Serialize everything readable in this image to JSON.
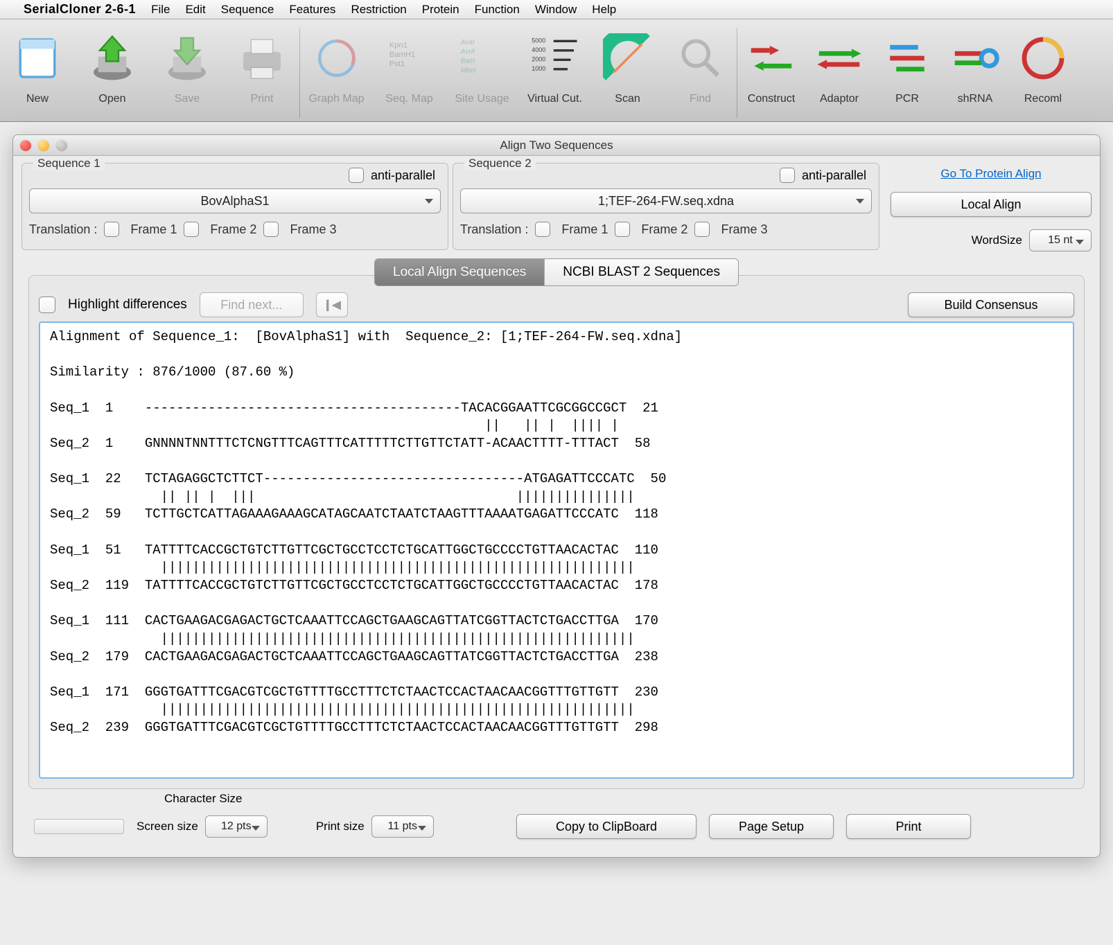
{
  "menubar": {
    "appname": "SerialCloner 2-6-1",
    "items": [
      "File",
      "Edit",
      "Sequence",
      "Features",
      "Restriction",
      "Protein",
      "Function",
      "Window",
      "Help"
    ]
  },
  "toolbar": [
    {
      "label": "New",
      "icon": "new"
    },
    {
      "label": "Open",
      "icon": "open"
    },
    {
      "label": "Save",
      "icon": "save",
      "disabled": true
    },
    {
      "label": "Print",
      "icon": "print",
      "disabled": true
    },
    {
      "divider": true
    },
    {
      "label": "Graph Map",
      "icon": "graphmap",
      "disabled": true
    },
    {
      "label": "Seq. Map",
      "icon": "seqmap",
      "disabled": true
    },
    {
      "label": "Site Usage",
      "icon": "siteusage",
      "disabled": true
    },
    {
      "label": "Virtual Cut.",
      "icon": "virtualcut"
    },
    {
      "label": "Scan",
      "icon": "scan"
    },
    {
      "label": "Find",
      "icon": "find",
      "disabled": true
    },
    {
      "divider": true
    },
    {
      "label": "Construct",
      "icon": "construct"
    },
    {
      "label": "Adaptor",
      "icon": "adaptor"
    },
    {
      "label": "PCR",
      "icon": "pcr"
    },
    {
      "label": "shRNA",
      "icon": "shrna"
    },
    {
      "label": "Recoml",
      "icon": "recombl"
    }
  ],
  "window": {
    "title": "Align Two Sequences"
  },
  "seq1": {
    "legend": "Sequence 1",
    "anti": "anti-parallel",
    "value": "BovAlphaS1",
    "translation_label": "Translation :",
    "frames": [
      "Frame 1",
      "Frame 2",
      "Frame 3"
    ]
  },
  "seq2": {
    "legend": "Sequence 2",
    "anti": "anti-parallel",
    "value": "1;TEF-264-FW.seq.xdna",
    "translation_label": "Translation :",
    "frames": [
      "Frame 1",
      "Frame 2",
      "Frame 3"
    ]
  },
  "right": {
    "protein_link": "Go To Protein Align",
    "local_align": "Local Align",
    "wordsize_label": "WordSize",
    "wordsize_value": "15 nt"
  },
  "tabs": {
    "active": "Local Align Sequences",
    "other": "NCBI BLAST 2 Sequences"
  },
  "group": {
    "highlight": "Highlight differences",
    "findnext": "Find next...",
    "rewind": "❙◀",
    "build": "Build Consensus"
  },
  "alignment": {
    "header": "Alignment of Sequence_1:  [BovAlphaS1] with  Sequence_2: [1;TEF-264-FW.seq.xdna]",
    "similarity": "Similarity : 876/1000 (87.60 %)",
    "blocks": [
      {
        "s1_left": "Seq_1  1    ",
        "s1_seq": "----------------------------------------TACACGGAATTCGCGGCCGCT",
        "s1_right": "  21",
        "mid": "                                                       ||   || |  |||| |  ",
        "s2_left": "Seq_2  1    ",
        "s2_seq": "GNNNNTNNTTTCTCNGTTTCAGTTTCATTTTTCTTGTTCTATT-ACAACTTTT-TTTACT",
        "s2_right": "  58"
      },
      {
        "s1_left": "Seq_1  22   ",
        "s1_seq": "TCTAGAGGCTCTTCT---------------------------------ATGAGATTCCCATC",
        "s1_right": "  50",
        "mid": "              || || |  |||                                 |||||||||||||||",
        "s2_left": "Seq_2  59   ",
        "s2_seq": "TCTTGCTCATTAGAAAGAAAGCATAGCAATCTAATCTAAGTTTAAAATGAGATTCCCATC",
        "s2_right": "  118"
      },
      {
        "s1_left": "Seq_1  51   ",
        "s1_seq": "TATTTTCACCGCTGTCTTGTTCGCTGCCTCCTCTGCATTGGCTGCCCCTGTTAACACTAC",
        "s1_right": "  110",
        "mid": "              ||||||||||||||||||||||||||||||||||||||||||||||||||||||||||||",
        "s2_left": "Seq_2  119  ",
        "s2_seq": "TATTTTCACCGCTGTCTTGTTCGCTGCCTCCTCTGCATTGGCTGCCCCTGTTAACACTAC",
        "s2_right": "  178"
      },
      {
        "s1_left": "Seq_1  111  ",
        "s1_seq": "CACTGAAGACGAGACTGCTCAAATTCCAGCTGAAGCAGTTATCGGTTACTCTGACCTTGA",
        "s1_right": "  170",
        "mid": "              ||||||||||||||||||||||||||||||||||||||||||||||||||||||||||||",
        "s2_left": "Seq_2  179  ",
        "s2_seq": "CACTGAAGACGAGACTGCTCAAATTCCAGCTGAAGCAGTTATCGGTTACTCTGACCTTGA",
        "s2_right": "  238"
      },
      {
        "s1_left": "Seq_1  171  ",
        "s1_seq": "GGGTGATTTCGACGTCGCTGTTTTGCCTTTCTCTAACTCCACTAACAACGGTTTGTTGTT",
        "s1_right": "  230",
        "mid": "              ||||||||||||||||||||||||||||||||||||||||||||||||||||||||||||",
        "s2_left": "Seq_2  239  ",
        "s2_seq": "GGGTGATTTCGACGTCGCTGTTTTGCCTTTCTCTAACTCCACTAACAACGGTTTGTTGTT",
        "s2_right": "  298"
      }
    ]
  },
  "bottom": {
    "char_title": "Character Size",
    "screen_label": "Screen size",
    "screen_value": "12 pts",
    "print_label": "Print size",
    "print_value": "11 pts",
    "copy": "Copy to ClipBoard",
    "pagesetup": "Page Setup",
    "print": "Print"
  }
}
